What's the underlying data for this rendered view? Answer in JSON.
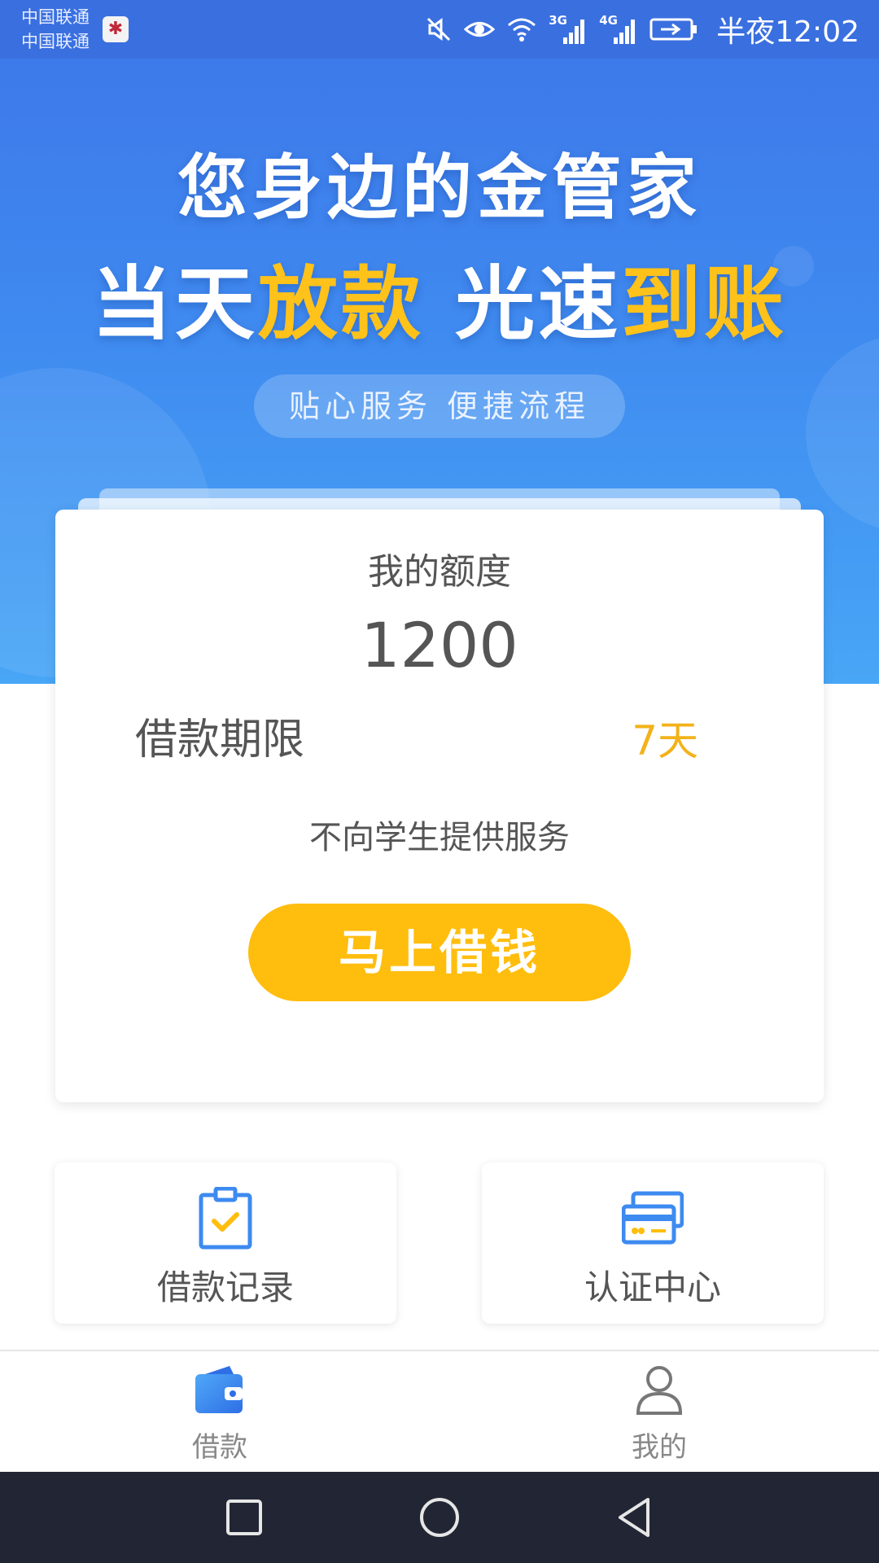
{
  "status_bar": {
    "carrier_1": "中国联通",
    "carrier_2": "中国联通",
    "network_1": "3G",
    "network_2": "4G",
    "time": "半夜12:02",
    "icons": [
      "mute-icon",
      "eye-icon",
      "wifi-icon",
      "signal-3g-icon",
      "signal-4g-icon",
      "battery-charging-icon"
    ]
  },
  "hero": {
    "title": "您身边的金管家",
    "slogan_part1": "当天",
    "slogan_part2": "放款",
    "slogan_part3": "光速",
    "slogan_part4": "到账",
    "tagline": "贴心服务  便捷流程",
    "accent_color": "#ffc21a"
  },
  "quota_card": {
    "label": "我的额度",
    "amount": "1200",
    "term_label": "借款期限",
    "term_value": "7天",
    "notice": "不向学生提供服务",
    "button_label": "马上借钱",
    "button_color": "#ffbd0e"
  },
  "shortcuts": [
    {
      "label": "借款记录",
      "icon": "clipboard-check-icon"
    },
    {
      "label": "认证中心",
      "icon": "credit-card-icon"
    }
  ],
  "tab_bar": {
    "tabs": [
      {
        "label": "借款",
        "icon": "wallet-icon",
        "active": true
      },
      {
        "label": "我的",
        "icon": "person-icon",
        "active": false
      }
    ]
  },
  "nav_bar": {
    "buttons": [
      "recents-square-icon",
      "home-circle-icon",
      "back-triangle-icon"
    ]
  }
}
